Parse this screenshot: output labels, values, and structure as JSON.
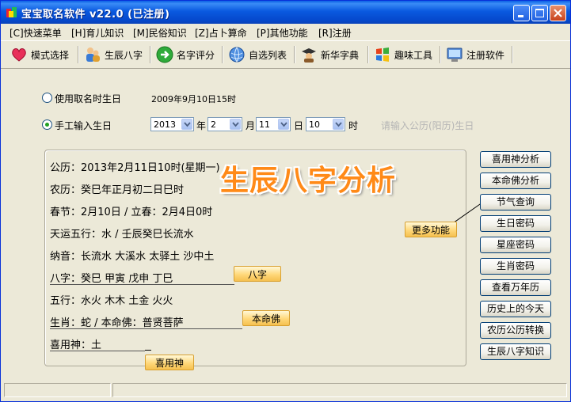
{
  "window": {
    "title": "宝宝取名软件 v22.0 (已注册)"
  },
  "menu": [
    "[C]快速菜单",
    "[H]育儿知识",
    "[M]民俗知识",
    "[Z]占卜算命",
    "[P]其他功能",
    "[R]注册"
  ],
  "toolbar": [
    {
      "label": "模式选择",
      "icon": "heart-icon"
    },
    {
      "label": "生辰八字",
      "icon": "people-icon"
    },
    {
      "label": "名字评分",
      "icon": "arrow-right-icon"
    },
    {
      "label": "自选列表",
      "icon": "globe-icon"
    },
    {
      "label": "新华字典",
      "icon": "scholar-icon"
    },
    {
      "label": "趣味工具",
      "icon": "windows-flag-icon"
    },
    {
      "label": "注册软件",
      "icon": "monitor-icon"
    }
  ],
  "birth": {
    "use_name_birth_label": "使用取名时生日",
    "name_birth_value": "2009年9月10日15时",
    "manual_label": "手工输入生日",
    "year": "2013",
    "year_unit": "年",
    "month": "2",
    "month_unit": "月",
    "day": "11",
    "day_unit": "日",
    "hour": "10",
    "hour_unit": "时",
    "hint": "请输入公历(阳历)生日"
  },
  "result": {
    "heading": "生辰八字分析",
    "gongli": "公历：2013年2月11日10时(星期一)",
    "nongli": "农历：癸巳年正月初二日巳时",
    "chunjie": "春节：2月10日 / 立春：2月4日0时",
    "tianyun": "天运五行：水 / 壬辰癸巳长流水",
    "nayin": "纳音：长流水 大溪水 太驿土 沙中土",
    "bazi": "八字：癸巳 甲寅 戊申 丁巳",
    "wuxing": "五行：水火 木木 土金 火火",
    "shengxiao": "生肖：蛇 / 本命佛：普贤菩萨",
    "xiyong": "喜用神：土"
  },
  "tags": {
    "more": "更多功能",
    "bazi": "八字",
    "benmingfo": "本命佛",
    "xiyongshen": "喜用神"
  },
  "side_buttons": [
    "喜用神分析",
    "本命佛分析",
    "节气查询",
    "生日密码",
    "星座密码",
    "生肖密码",
    "查看万年历",
    "历史上的今天",
    "农历公历转换",
    "生辰八字知识"
  ]
}
